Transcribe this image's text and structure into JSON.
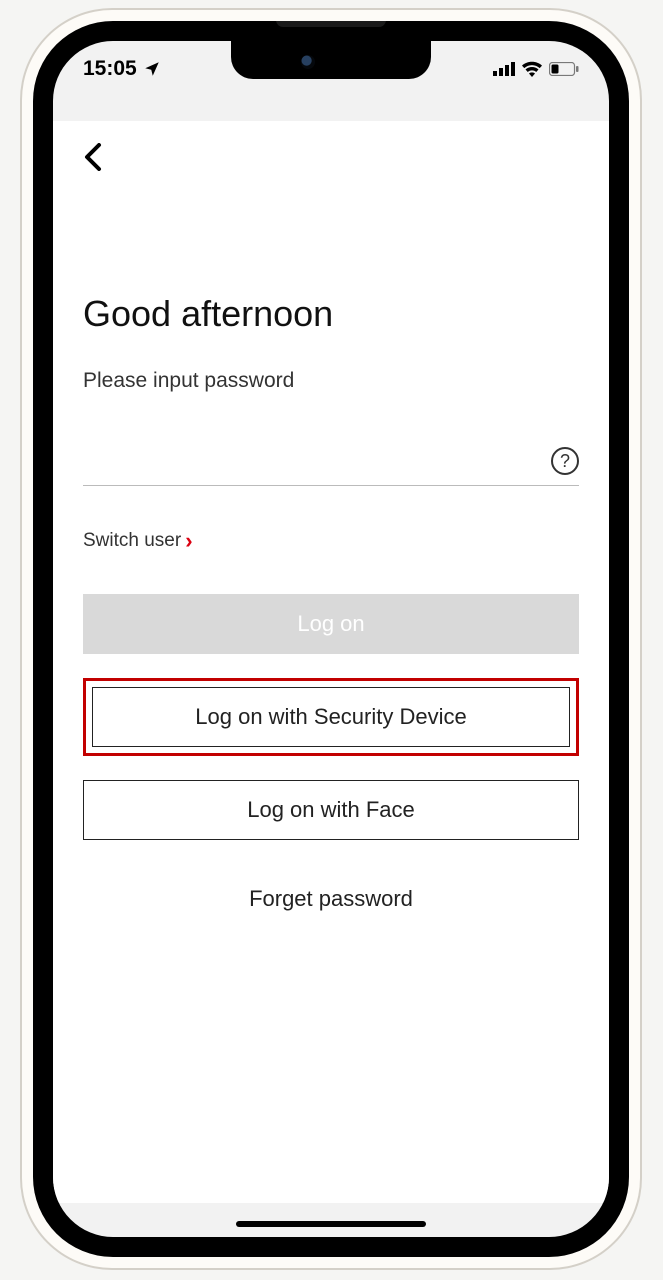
{
  "status": {
    "time": "15:05"
  },
  "content": {
    "greeting": "Good afternoon",
    "prompt": "Please input password",
    "switch_user": "Switch user",
    "logon": "Log on",
    "logon_security": "Log on with Security Device",
    "logon_face": "Log on with Face",
    "forget": "Forget password",
    "help_glyph": "?"
  }
}
